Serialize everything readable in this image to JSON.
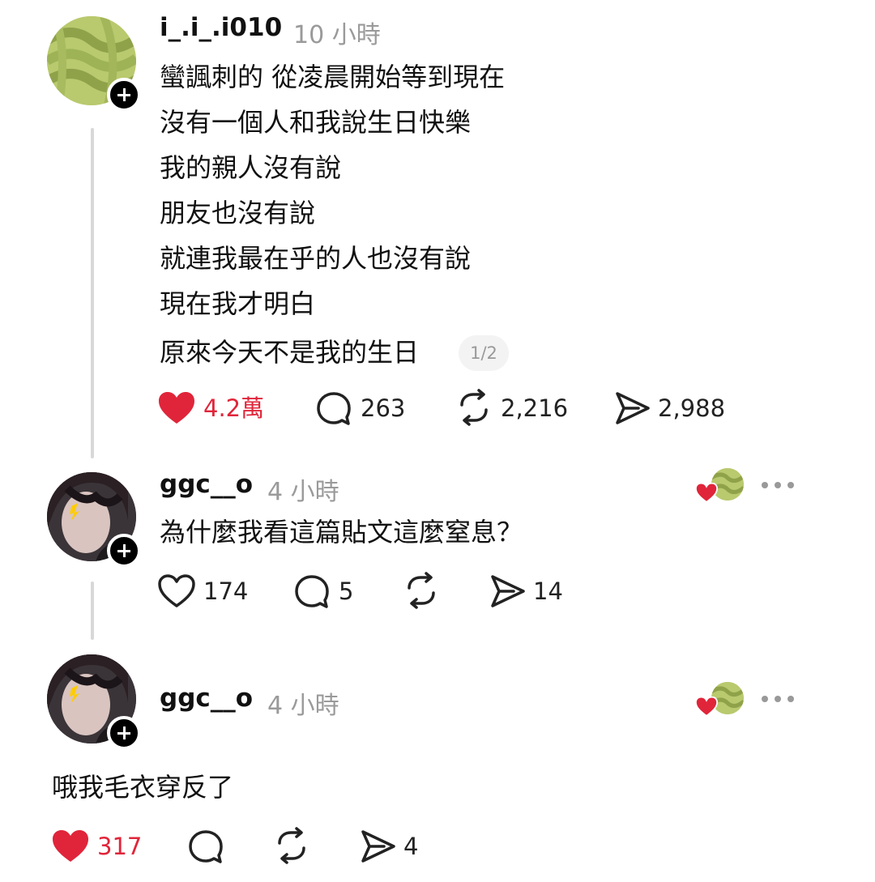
{
  "post": {
    "username": "i_.i_.i010",
    "time": "10 小時",
    "lines": [
      "蠻諷刺的 從凌晨開始等到現在",
      "沒有一個人和我說生日快樂",
      "我的親人沒有說",
      "朋友也沒有說",
      "就連我最在乎的人也沒有說",
      "現在我才明白",
      "原來今天不是我的生日"
    ],
    "page_indicator": "1/2",
    "likes": "4.2萬",
    "comments": "263",
    "reposts": "2,216",
    "shares": "2,988"
  },
  "reply1": {
    "username": "ggc__o",
    "time": "4 小時",
    "text": "為什麼我看這篇貼文這麼窒息？",
    "likes": "174",
    "comments": "5",
    "shares": "14"
  },
  "reply2": {
    "username": "ggc__o",
    "time": "4 小時",
    "text": "哦我毛衣穿反了",
    "likes": "317",
    "shares": "4"
  },
  "colors": {
    "like_red": "#e0253a",
    "muted_gray": "#9a9a9a",
    "thread_line": "#d8d8d8"
  },
  "icons": [
    "heart-icon",
    "comment-icon",
    "repost-icon",
    "share-icon",
    "more-icon",
    "plus-icon"
  ]
}
